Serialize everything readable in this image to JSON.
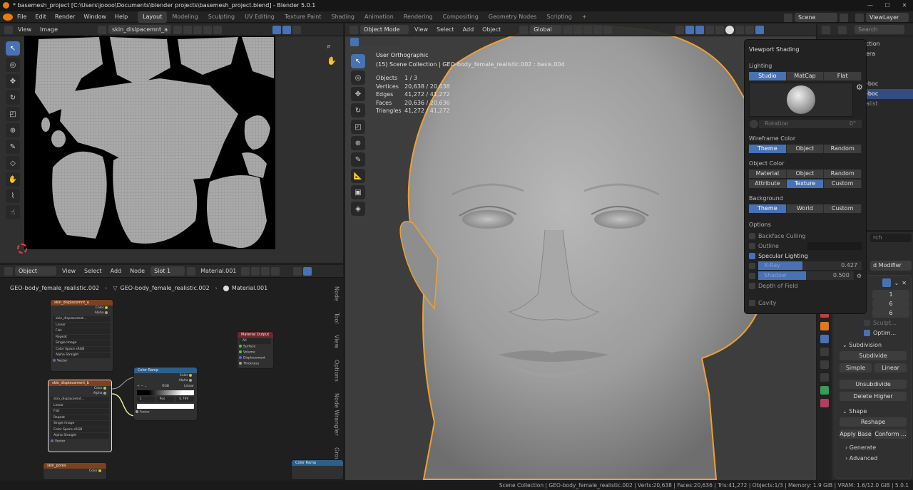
{
  "title": "* basemesh_project [C:\\Users\\joooo\\Documents\\blender projects\\basemesh_project.blend] - Blender 5.0.1",
  "menu": [
    "File",
    "Edit",
    "Render",
    "Window",
    "Help"
  ],
  "workspaces": [
    "Layout",
    "Modeling",
    "Sculpting",
    "UV Editing",
    "Texture Paint",
    "Shading",
    "Animation",
    "Rendering",
    "Compositing",
    "Geometry Nodes",
    "Scripting",
    "+"
  ],
  "scene": "Scene",
  "view_layer": "ViewLayer",
  "image_editor": {
    "menu": [
      "View",
      "Image"
    ],
    "image_name": "skin_dislpacemnt_a"
  },
  "node_editor": {
    "object_label": "Object",
    "menu": [
      "View",
      "Select",
      "Add",
      "Node"
    ],
    "slot": "Slot 1",
    "material": "Material.001",
    "breadcrumb": [
      "GEO-body_female_realistic.002",
      "GEO-body_female_realistic.002",
      "Material.001"
    ],
    "side_tabs": [
      "Node",
      "Tool",
      "View",
      "Options",
      "Node Wrangler",
      "Group"
    ],
    "node_a": {
      "title": "skin_displacemnt_a",
      "outputs": [
        "Color",
        "Alpha"
      ],
      "rows": [
        "skin_displacemnt...",
        "Linear",
        "Flat",
        "Repeat",
        "Single Image",
        "Color Space  sRGB",
        "Alpha  Straight"
      ],
      "vector": "Vector"
    },
    "node_b": {
      "title": "skin_displacement_b",
      "outputs": [
        "Color",
        "Alpha"
      ],
      "rows": [
        "skin_displacemnt...",
        "Linear",
        "Flat",
        "Repeat",
        "Single Image",
        "Color Space  sRGB",
        "Alpha  Straight"
      ],
      "vector": "Vector"
    },
    "node_output": {
      "title": "Material Output",
      "all": "All",
      "inputs": [
        "Surface",
        "Volume",
        "Displacement",
        "Thickness"
      ]
    },
    "node_ramp": {
      "title": "Color Ramp",
      "outputs": [
        "Color",
        "Alpha"
      ],
      "mode": "RGB",
      "interp": "Linear",
      "pos_index": "1",
      "pos_label": "Pos",
      "pos_value": "0.799",
      "factor": "Factor"
    },
    "node_c": {
      "title": "skin_pores"
    },
    "node_ramp2": {
      "title": "Color Ramp"
    }
  },
  "viewport": {
    "mode": "Object Mode",
    "menu": [
      "View",
      "Select",
      "Add",
      "Object"
    ],
    "transform": "Global",
    "view_name": "User Orthographic",
    "collection_line": "(15) Scene Collection | GEO-body_female_realistic.002 : basis.004",
    "stats": [
      [
        "Objects",
        "1 / 3"
      ],
      [
        "Vertices",
        "20,638 / 20,638"
      ],
      [
        "Edges",
        "41,272 / 41,272"
      ],
      [
        "Faces",
        "20,636 / 20,636"
      ],
      [
        "Triangles",
        "41,272 / 41,272"
      ]
    ]
  },
  "shading_popup": {
    "title": "Viewport Shading",
    "lighting_label": "Lighting",
    "lighting": [
      "Studio",
      "MatCap",
      "Flat"
    ],
    "rotation_label": "Rotation",
    "rotation_value": "0°",
    "wire_label": "Wireframe Color",
    "wire": [
      "Theme",
      "Object",
      "Random"
    ],
    "objcolor_label": "Object Color",
    "objcolor_row1": [
      "Material",
      "Object",
      "Random"
    ],
    "objcolor_row2": [
      "Attribute",
      "Texture",
      "Custom"
    ],
    "bg_label": "Background",
    "bg": [
      "Theme",
      "World",
      "Custom"
    ],
    "options_label": "Options",
    "backface": "Backface Culling",
    "outline": "Outline",
    "specular": "Specular Lighting",
    "xray": "X-Ray",
    "xray_value": "0.427",
    "shadow": "Shadow",
    "shadow_value": "0.500",
    "dof": "Depth of Field",
    "cavity": "Cavity"
  },
  "outliner": {
    "search": "Search",
    "items": [
      "ction",
      "era",
      "-boc",
      "-boc",
      "alist"
    ]
  },
  "properties": {
    "search": "rch",
    "add_modifier": "d Modifier",
    "levels": [
      "1",
      "6",
      "6"
    ],
    "sculpt": "Sculpt...",
    "optimal": "Optim...",
    "subdivision": "Subdivision",
    "subdivide": "Subdivide",
    "simple": "Simple",
    "linear": "Linear",
    "unsubdivide": "Unsubdivide",
    "delete_higher": "Delete Higher",
    "shape": "Shape",
    "reshape": "Reshape",
    "apply_base": "Apply Base",
    "conform": "Conform ...",
    "generate": "Generate",
    "advanced": "Advanced"
  },
  "status_bar": "Scene Collection | GEO-body_female_realistic.002 | Verts:20,638 | Faces:20,636 | Tris:41,272 | Objects:1/3 | Memory: 1.9 GiB | VRAM: 1.6/12.0 GiB | 5.0.1",
  "colors": {
    "accent": "#4772b3",
    "selection_outline": "#f0a030",
    "node_image_header": "#7a4220",
    "node_output_header": "#6b2a2a",
    "node_ramp_header": "#2d6089"
  }
}
